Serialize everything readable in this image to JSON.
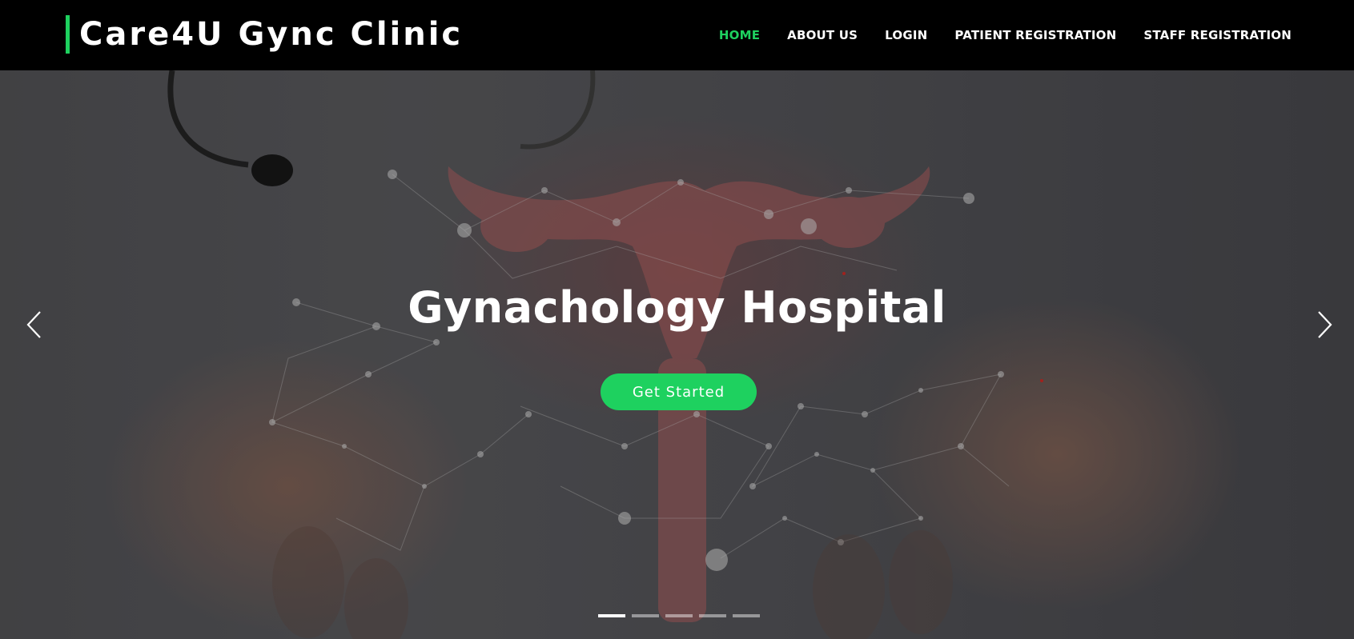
{
  "brand": {
    "name": "Care4U Gync Clinic",
    "accent_color": "#1ed15f"
  },
  "nav": {
    "items": [
      {
        "label": "HOME",
        "active": true
      },
      {
        "label": "ABOUT US",
        "active": false
      },
      {
        "label": "LOGIN",
        "active": false
      },
      {
        "label": "PATIENT REGISTRATION",
        "active": false
      },
      {
        "label": "STAFF REGISTRATION",
        "active": false
      }
    ],
    "active_color": "#1ed15f"
  },
  "hero": {
    "title": "Gynachology Hospital",
    "cta_label": "Get Started",
    "cta_color": "#1ed15f",
    "prev_icon": "chevron-left-icon",
    "next_icon": "chevron-right-icon",
    "slides": {
      "count": 5,
      "active_index": 0
    }
  }
}
